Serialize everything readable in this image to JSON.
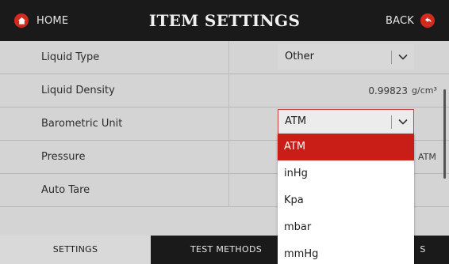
{
  "header": {
    "home_label": "HOME",
    "title": "ITEM SETTINGS",
    "back_label": "BACK",
    "accent_color": "#d32a1e"
  },
  "rows": [
    {
      "label": "Liquid Type",
      "control": "select",
      "value": "Other"
    },
    {
      "label": "Liquid Density",
      "control": "value",
      "value": "0.99823",
      "unit": "g/cm³"
    },
    {
      "label": "Barometric Unit",
      "control": "select",
      "value": "ATM",
      "open": true
    },
    {
      "label": "Pressure",
      "control": "value",
      "unit": "ATM"
    },
    {
      "label": "Auto Tare",
      "control": "toggle"
    }
  ],
  "barometric_dropdown": {
    "options": [
      "ATM",
      "inHg",
      "Kpa",
      "mbar",
      "mmHg"
    ],
    "selected": "ATM",
    "highlight_color": "#c91d17"
  },
  "tabs": [
    {
      "label": "SETTINGS",
      "active": true
    },
    {
      "label": "TEST METHODS",
      "active": false
    },
    {
      "label": "S",
      "active": false
    }
  ]
}
